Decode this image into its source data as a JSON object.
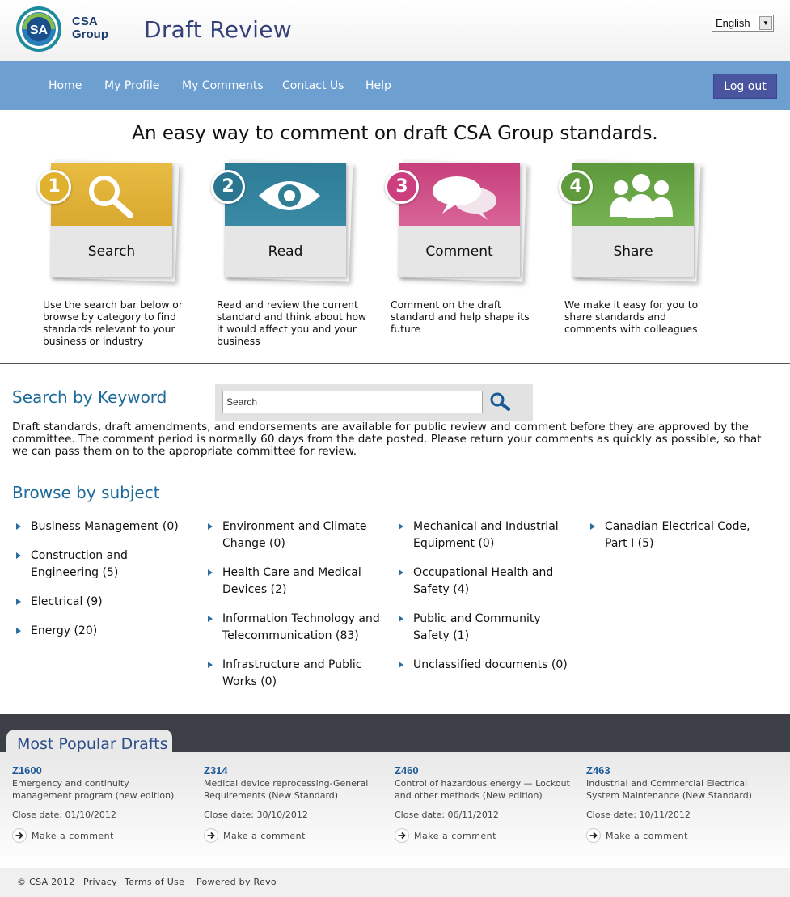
{
  "header": {
    "logo_text_line1": "CSA",
    "logo_text_line2": "Group",
    "title": "Draft Review",
    "language": "English"
  },
  "nav": {
    "items": [
      "Home",
      "My Profile",
      "My Comments",
      "Contact Us",
      "Help"
    ],
    "logout": "Log out"
  },
  "tagline": "An easy way to comment on draft CSA Group standards.",
  "steps": [
    {
      "num": "1",
      "label": "Search",
      "desc": "Use the search bar below or browse by category to find standards relevant to your business or industry",
      "color": "#e3b43a",
      "icon": "magnifier-icon"
    },
    {
      "num": "2",
      "label": "Read",
      "desc": "Read and review the current standard and think about how it would affect you and your business",
      "color": "#2f7e96",
      "icon": "eye-icon"
    },
    {
      "num": "3",
      "label": "Comment",
      "desc": "Comment on the draft standard and help shape its future",
      "color": "#cf4a85",
      "icon": "speech-bubbles-icon"
    },
    {
      "num": "4",
      "label": "Share",
      "desc": "We make it easy for you to share standards and comments with colleagues",
      "color": "#64a043",
      "icon": "people-icon"
    }
  ],
  "search": {
    "heading": "Search by Keyword",
    "placeholder": "Search",
    "description": "Draft standards, draft amendments, and endorsements are available for public review and comment before they are approved by the committee. The comment period is normally 60 days from the date posted. Please return your comments as quickly as possible, so that we can pass them on to the appropriate committee for review."
  },
  "browse": {
    "heading": "Browse by subject",
    "columns": [
      [
        "Business Management (0)",
        "Construction and Engineering (5)",
        "Electrical (9)",
        "Energy (20)"
      ],
      [
        "Environment and Climate Change (0)",
        "Health Care and Medical Devices (2)",
        "Information Technology and Telecommunication (83)",
        "Infrastructure and Public Works (0)"
      ],
      [
        "Mechanical and Industrial Equipment (0)",
        "Occupational Health and Safety (4)",
        "Public and Community Safety (1)",
        "Unclassified documents (0)"
      ],
      [
        "Canadian Electrical Code, Part I (5)"
      ]
    ]
  },
  "popular": {
    "heading": "Most Popular Drafts",
    "drafts": [
      {
        "code": "Z1600",
        "desc": "Emergency and continuity management program (new edition)",
        "close": "Close date: 01/10/2012",
        "link": "Make a comment"
      },
      {
        "code": "Z314",
        "desc": "Medical device reprocessing-General Requirements (New Standard)",
        "close": "Close date: 30/10/2012",
        "link": "Make a comment"
      },
      {
        "code": "Z460",
        "desc": "Control of hazardous energy — Lockout and other methods (New edition)",
        "close": "Close date: 06/11/2012",
        "link": "Make a comment"
      },
      {
        "code": "Z463",
        "desc": "Industrial and Commercial Electrical System Maintenance (New Standard)",
        "close": "Close date: 10/11/2012",
        "link": "Make a comment"
      }
    ]
  },
  "footer": {
    "copyright": "© CSA 2012",
    "privacy": "Privacy",
    "terms": "Terms of Use",
    "powered": "Powered by Revo"
  }
}
